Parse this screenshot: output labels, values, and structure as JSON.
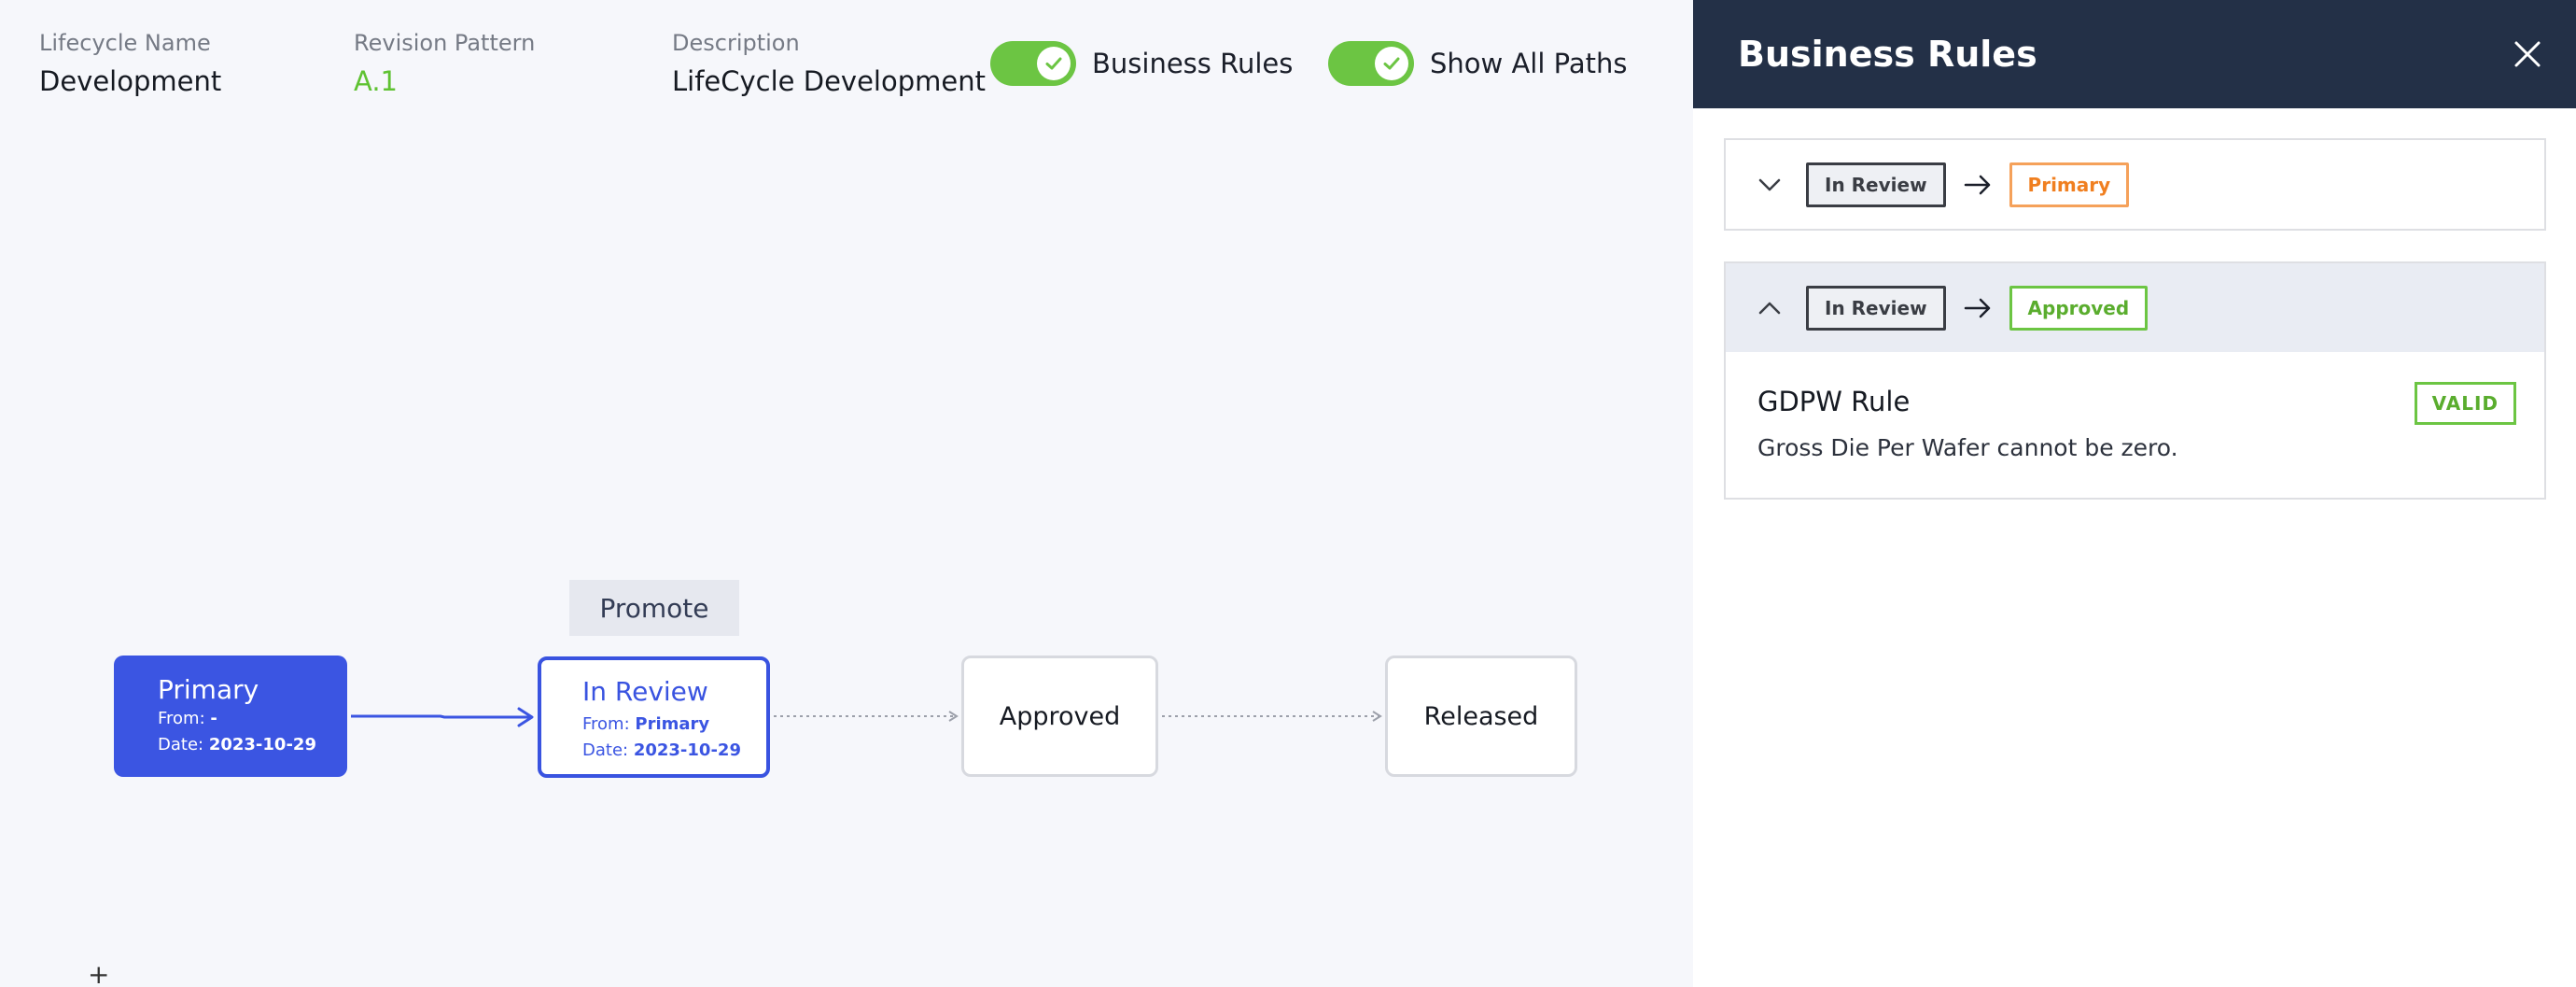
{
  "header": {
    "lifecycle_name_label": "Lifecycle Name",
    "lifecycle_name_value": "Development",
    "revision_pattern_label": "Revision Pattern",
    "revision_pattern_value": "A.1",
    "description_label": "Description",
    "description_value": "LifeCycle Development",
    "toggles": [
      {
        "label": "Business Rules",
        "on": true
      },
      {
        "label": "Show All Paths",
        "on": true
      }
    ]
  },
  "flow": {
    "promote_label": "Promote",
    "nodes": [
      {
        "name": "Primary",
        "from_label": "From:",
        "from_value": "-",
        "date_label": "Date:",
        "date_value": "2023-10-29",
        "state": "completed"
      },
      {
        "name": "In Review",
        "from_label": "From:",
        "from_value": "Primary",
        "date_label": "Date:",
        "date_value": "2023-10-29",
        "state": "current"
      },
      {
        "name": "Approved",
        "state": "pending"
      },
      {
        "name": "Released",
        "state": "pending"
      }
    ],
    "add_symbol": "+"
  },
  "panel": {
    "title": "Business Rules",
    "transitions": [
      {
        "from": "In Review",
        "to": "Primary",
        "expanded": false
      },
      {
        "from": "In Review",
        "to": "Approved",
        "expanded": true,
        "rule": {
          "name": "GDPW Rule",
          "description": "Gross Die Per Wafer cannot be zero.",
          "status": "VALID"
        }
      }
    ]
  },
  "colors": {
    "primary_blue": "#3b55e2",
    "panel_header": "#233047",
    "toggle_green": "#6cc543",
    "orange": "#f07f20",
    "background": "#f6f7fb"
  },
  "icons": [
    "check-icon",
    "close-icon",
    "chevron-down-icon",
    "chevron-up-icon",
    "arrow-right-icon",
    "plus-icon"
  ]
}
